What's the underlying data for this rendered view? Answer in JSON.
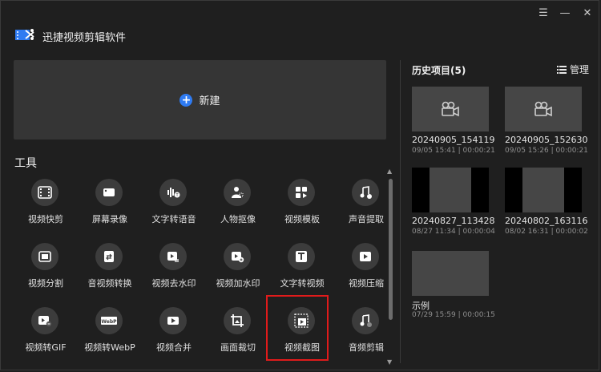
{
  "app": {
    "title": "迅捷视频剪辑软件",
    "window_controls": {
      "menu": "☰",
      "minimize": "—",
      "close": "✕"
    }
  },
  "new_project": {
    "label": "新建",
    "icon": "plus-circle-icon",
    "accent": "#2f7bf2"
  },
  "tools": {
    "title": "工具",
    "items": [
      {
        "label": "视频快剪",
        "icon": "film-icon"
      },
      {
        "label": "屏幕录像",
        "icon": "camera-icon"
      },
      {
        "label": "文字转语音",
        "icon": "text-to-speech-icon"
      },
      {
        "label": "人物抠像",
        "icon": "person-cutout-icon"
      },
      {
        "label": "视频模板",
        "icon": "template-icon"
      },
      {
        "label": "声音提取",
        "icon": "audio-extract-icon"
      },
      {
        "label": "视频分割",
        "icon": "split-icon"
      },
      {
        "label": "音视频转换",
        "icon": "convert-icon"
      },
      {
        "label": "视频去水印",
        "icon": "remove-watermark-icon"
      },
      {
        "label": "视频加水印",
        "icon": "add-watermark-icon"
      },
      {
        "label": "文字转视频",
        "icon": "text-to-video-icon"
      },
      {
        "label": "视频压缩",
        "icon": "compress-icon"
      },
      {
        "label": "视频转GIF",
        "icon": "gif-icon"
      },
      {
        "label": "视频转WebP",
        "icon": "webp-icon"
      },
      {
        "label": "视频合并",
        "icon": "merge-icon"
      },
      {
        "label": "画面裁切",
        "icon": "crop-icon"
      },
      {
        "label": "视频截图",
        "icon": "screenshot-icon",
        "selected": true
      },
      {
        "label": "音频剪辑",
        "icon": "audio-cut-icon"
      }
    ]
  },
  "history": {
    "title": "历史项目(5)",
    "manage_label": "管理",
    "projects": [
      {
        "name": "20240905_154119",
        "meta": "09/05 15:41 | 00:00:21",
        "thumb": "placeholder"
      },
      {
        "name": "20240905_152630",
        "meta": "09/05 15:26 | 00:00:21",
        "thumb": "placeholder"
      },
      {
        "name": "20240827_113428",
        "meta": "08/27 11:34 | 00:00:04",
        "thumb": "sandy"
      },
      {
        "name": "20240802_163116",
        "meta": "08/02 16:31 | 00:00:02",
        "thumb": "sandy"
      },
      {
        "name": "示例",
        "meta": "07/29 15:59 | 00:00:15",
        "thumb": "aerial"
      }
    ]
  },
  "colors": {
    "background": "#1f1f1f",
    "card": "#353535",
    "highlight": "#e01b1b",
    "accent": "#2f7bf2"
  }
}
